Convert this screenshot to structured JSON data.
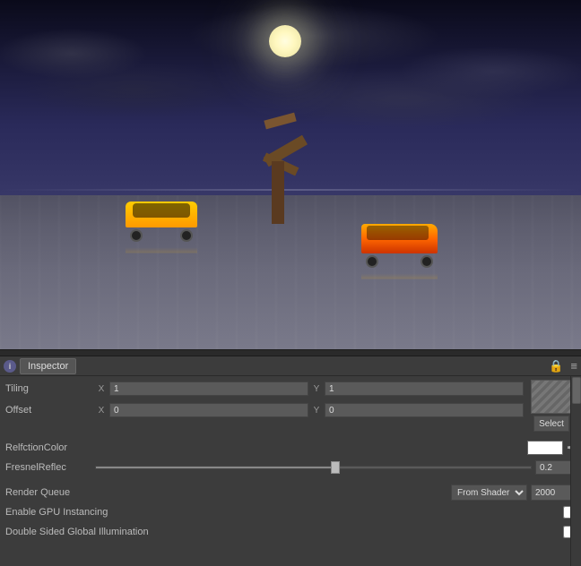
{
  "viewport": {
    "label": "3D Viewport"
  },
  "inspector": {
    "tab_label": "Inspector",
    "info_icon": "i",
    "lock_icon": "🔒",
    "menu_icon": "≡",
    "tiling": {
      "label": "Tiling",
      "x_label": "X",
      "x_value": "1",
      "y_label": "Y",
      "y_value": "1"
    },
    "offset": {
      "label": "Offset",
      "x_label": "X",
      "x_value": "0",
      "y_label": "Y",
      "y_value": "0"
    },
    "select_button": "Select",
    "relfction_color": {
      "label": "RelfctionColor"
    },
    "fresnel_reflec": {
      "label": "FresnelReflec",
      "value": "0.2",
      "slider_pct": 55
    },
    "render_queue": {
      "label": "Render Queue",
      "dropdown_option": "From Shader",
      "value": "2000"
    },
    "enable_gpu": {
      "label": "Enable GPU Instancing"
    },
    "double_sided": {
      "label": "Double Sided Global Illumination"
    }
  },
  "colors": {
    "bg": "#3c3c3c",
    "panel_bg": "#3c3c3c",
    "input_bg": "#5a5a5a",
    "border": "#444444",
    "text": "#dddddd",
    "label": "#bbbbbb"
  }
}
